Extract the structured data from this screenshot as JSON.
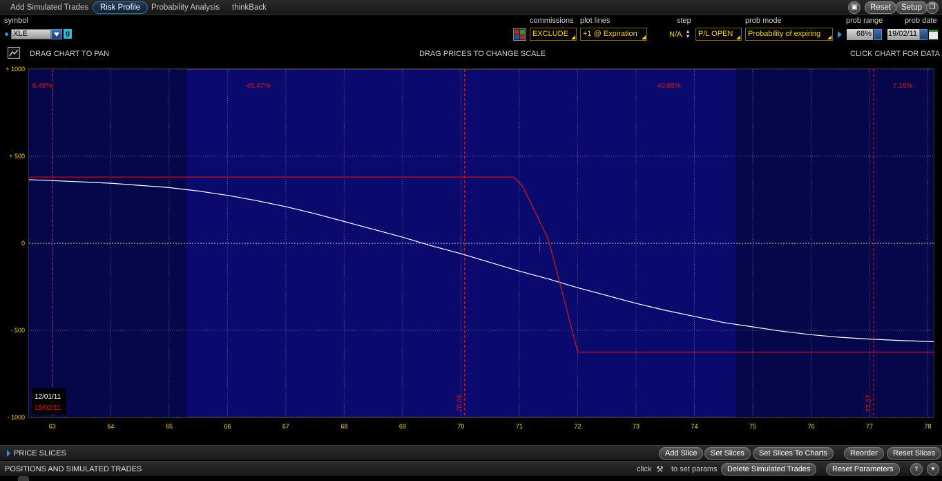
{
  "tabs": [
    {
      "label": "Add Simulated Trades",
      "active": false
    },
    {
      "label": "Risk Profile",
      "active": true
    },
    {
      "label": "Probability Analysis",
      "active": false
    },
    {
      "label": "thinkBack",
      "active": false
    }
  ],
  "top_buttons": {
    "print_icon": "printer-icon",
    "reset": "Reset",
    "setup": "Setup",
    "window_icon": "window-icon"
  },
  "params": {
    "symbol_label": "symbol",
    "symbol_value": "XLE",
    "symbol_g": "g",
    "commissions_label": "commissions",
    "commissions_value": "EXCLUDE",
    "plot_lines_label": "plot lines",
    "plot_lines_value": "+1 @ Expiration",
    "step_label": "step",
    "step_value": "N/A",
    "pl_value": "P/L OPEN",
    "prob_mode_label": "prob mode",
    "prob_mode_value": "Probability of expiring",
    "prob_range_label": "prob range",
    "prob_range_value": "68%",
    "prob_date_label": "prob date",
    "prob_date_value": "19/02/11"
  },
  "chart_header": {
    "left": "DRAG CHART TO PAN",
    "center": "DRAG PRICES TO CHANGE SCALE",
    "right": "CLICK CHART FOR DATA"
  },
  "colors": {
    "plot_bg": "#0a0a6e",
    "plot_bg_dark": "#06064a",
    "current_line": "#ffffff",
    "expiration_line": "#e01010",
    "marker": "#e01010",
    "axis_text": "#ffd400"
  },
  "chart_data": {
    "type": "line",
    "title": "",
    "xlabel": "",
    "ylabel": "",
    "xlim": [
      62.6,
      78.1
    ],
    "ylim": [
      -1000,
      1000
    ],
    "x_ticks": [
      63,
      64,
      65,
      66,
      67,
      68,
      69,
      70,
      71,
      72,
      73,
      74,
      75,
      76,
      77,
      78
    ],
    "y_ticks": [
      {
        "value": 1000,
        "label": "+ 1000"
      },
      {
        "value": 500,
        "label": "+ 500"
      },
      {
        "value": 0,
        "label": "0"
      },
      {
        "value": -500,
        "label": "- 500"
      },
      {
        "value": -1000,
        "label": "- 1000"
      }
    ],
    "probability_zones": [
      {
        "from": 62.6,
        "to": 63.0,
        "label": "6.49%"
      },
      {
        "from": 63.0,
        "to": 70.06,
        "label": "45.47%"
      },
      {
        "from": 70.06,
        "to": 77.07,
        "label": "40.88%"
      },
      {
        "from": 77.07,
        "to": 78.1,
        "label": "7.16%"
      }
    ],
    "shaded_ranges": [
      [
        62.6,
        65.3
      ],
      [
        74.7,
        78.1
      ]
    ],
    "markers": [
      {
        "x": 63.0,
        "label": ""
      },
      {
        "x": 70.06,
        "label": "70.06"
      },
      {
        "x": 77.07,
        "label": "77.07"
      }
    ],
    "series": [
      {
        "name": "12/01/11",
        "color": "#ffffff",
        "x": [
          62.6,
          63,
          64,
          65,
          65.5,
          66,
          66.5,
          67,
          67.5,
          68,
          68.5,
          69,
          69.5,
          70,
          70.5,
          71,
          71.5,
          72,
          72.5,
          73,
          73.5,
          74,
          74.5,
          75,
          75.5,
          76,
          76.5,
          77,
          77.5,
          78.1
        ],
        "y": [
          365,
          360,
          345,
          320,
          300,
          275,
          245,
          210,
          170,
          125,
          80,
          35,
          -15,
          -60,
          -110,
          -160,
          -205,
          -255,
          -300,
          -345,
          -385,
          -420,
          -455,
          -480,
          -505,
          -525,
          -540,
          -550,
          -558,
          -565
        ]
      },
      {
        "name": "19/02/11",
        "color": "#e01010",
        "x": [
          62.6,
          70.9,
          71.05,
          71.2,
          71.5,
          71.75,
          72.0,
          78.1
        ],
        "y": [
          380,
          380,
          330,
          230,
          20,
          -300,
          -625,
          -625
        ]
      }
    ]
  },
  "bottom": {
    "price_slices": "PRICE SLICES",
    "add_slice": "Add Slice",
    "set_slices": "Set Slices",
    "set_slices_to_charts": "Set Slices To Charts",
    "reorder": "Reorder",
    "reset_slices": "Reset Slices",
    "positions": "POSITIONS AND SIMULATED TRADES",
    "click": "click",
    "to_set_params": "to set params",
    "delete_simulated_trades": "Delete Simulated Trades",
    "reset_parameters": "Reset Parameters"
  }
}
